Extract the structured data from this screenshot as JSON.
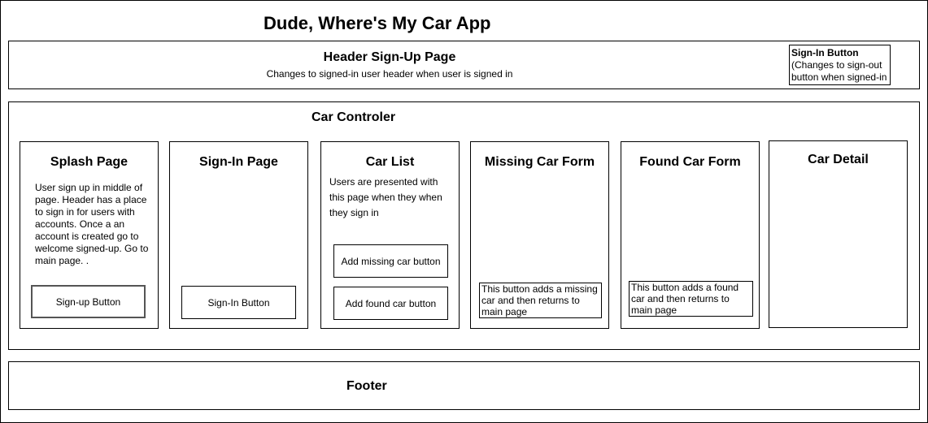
{
  "app_title": "Dude, Where's My Car App",
  "header": {
    "title": "Header Sign-Up Page",
    "subtitle": "Changes to signed-in user header when user is signed in",
    "signin_box": {
      "title": "Sign-In Button",
      "line1": "(Changes to sign-out",
      "line2": "button when signed-in"
    }
  },
  "controller": {
    "title": "Car Controler",
    "pages": {
      "splash": {
        "title": "Splash Page",
        "desc": "User sign up in middle of page. Header has a place to sign in for users with accounts. Once a an account is created go to welcome signed-up. Go to main page. .",
        "button": "Sign-up Button"
      },
      "signin": {
        "title": "Sign-In Page",
        "button": "Sign-In Button"
      },
      "carlist": {
        "title": "Car List",
        "desc": "Users are presented with this page when they when they sign in",
        "button_missing": "Add missing car button",
        "button_found": "Add found car button"
      },
      "missing": {
        "title": "Missing Car Form",
        "note": "This button adds a missing car and then returns to main page"
      },
      "found": {
        "title": "Found Car Form",
        "note": "This button adds a found car and then returns to main page"
      },
      "detail": {
        "title": "Car Detail"
      }
    }
  },
  "footer": {
    "title": "Footer"
  }
}
